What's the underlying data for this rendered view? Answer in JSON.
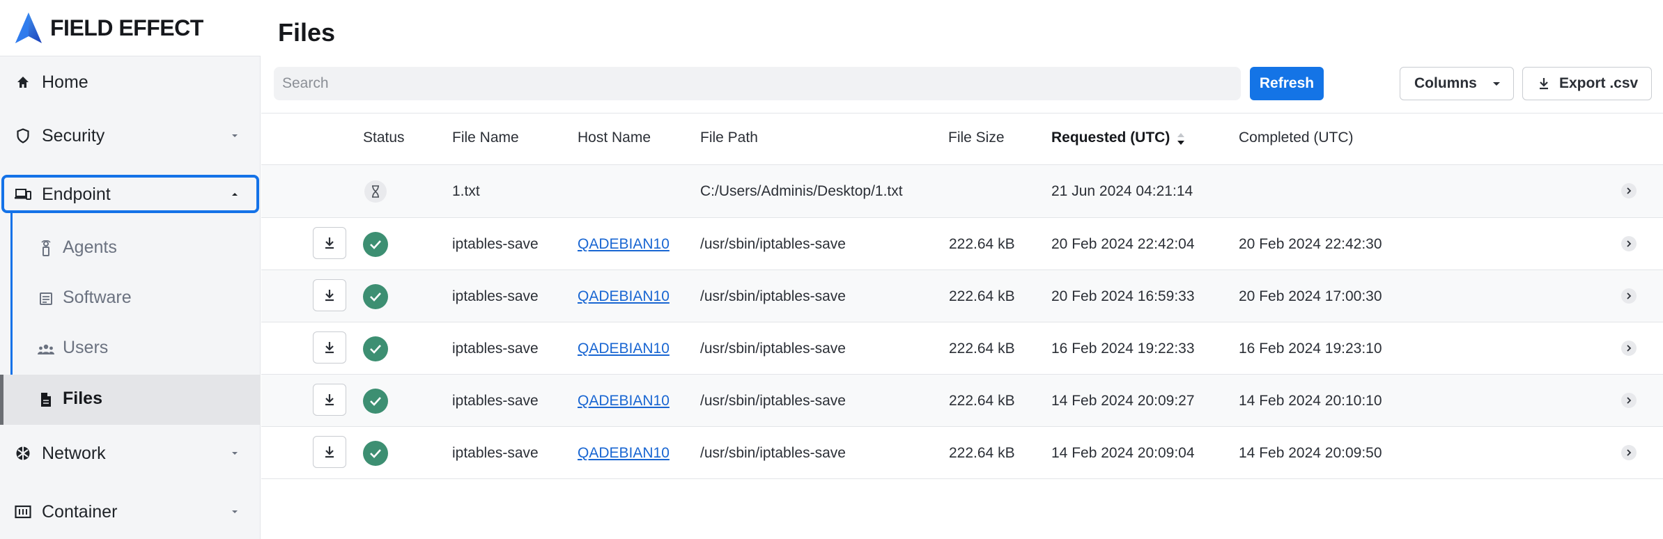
{
  "brand": {
    "name": "FIELD EFFECT"
  },
  "sidebar": {
    "items": [
      {
        "label": "Home",
        "icon": "home-icon"
      },
      {
        "label": "Security",
        "icon": "shield-icon"
      },
      {
        "label": "Endpoint",
        "icon": "devices-icon",
        "expanded": true
      },
      {
        "label": "Network",
        "icon": "network-icon"
      },
      {
        "label": "Container",
        "icon": "container-icon"
      }
    ],
    "endpoint_children": [
      {
        "label": "Agents",
        "icon": "agent-icon"
      },
      {
        "label": "Software",
        "icon": "software-icon"
      },
      {
        "label": "Users",
        "icon": "users-icon"
      },
      {
        "label": "Files",
        "icon": "file-icon",
        "active": true
      }
    ]
  },
  "page": {
    "title": "Files",
    "search_placeholder": "Search",
    "refresh_label": "Refresh",
    "columns_label": "Columns",
    "export_label": "Export .csv"
  },
  "table": {
    "headers": {
      "status": "Status",
      "file_name": "File Name",
      "host_name": "Host Name",
      "file_path": "File Path",
      "file_size": "File Size",
      "requested": "Requested (UTC)",
      "completed": "Completed (UTC)"
    },
    "sorted_column": "requested",
    "rows": [
      {
        "status": "pending",
        "file_name": "1.txt",
        "host_name": "",
        "file_path": "C:/Users/Adminis/Desktop/1.txt",
        "file_size": "",
        "requested": "21 Jun 2024 04:21:14",
        "completed": ""
      },
      {
        "status": "complete",
        "file_name": "iptables-save",
        "host_name": "QADEBIAN10",
        "file_path": "/usr/sbin/iptables-save",
        "file_size": "222.64 kB",
        "requested": "20 Feb 2024 22:42:04",
        "completed": "20 Feb 2024 22:42:30"
      },
      {
        "status": "complete",
        "file_name": "iptables-save",
        "host_name": "QADEBIAN10",
        "file_path": "/usr/sbin/iptables-save",
        "file_size": "222.64 kB",
        "requested": "20 Feb 2024 16:59:33",
        "completed": "20 Feb 2024 17:00:30"
      },
      {
        "status": "complete",
        "file_name": "iptables-save",
        "host_name": "QADEBIAN10",
        "file_path": "/usr/sbin/iptables-save",
        "file_size": "222.64 kB",
        "requested": "16 Feb 2024 19:22:33",
        "completed": "16 Feb 2024 19:23:10"
      },
      {
        "status": "complete",
        "file_name": "iptables-save",
        "host_name": "QADEBIAN10",
        "file_path": "/usr/sbin/iptables-save",
        "file_size": "222.64 kB",
        "requested": "14 Feb 2024 20:09:27",
        "completed": "14 Feb 2024 20:10:10"
      },
      {
        "status": "complete",
        "file_name": "iptables-save",
        "host_name": "QADEBIAN10",
        "file_path": "/usr/sbin/iptables-save",
        "file_size": "222.64 kB",
        "requested": "14 Feb 2024 20:09:04",
        "completed": "14 Feb 2024 20:09:50"
      }
    ]
  },
  "colors": {
    "accent": "#1474e6",
    "status_ok": "#3d8f72",
    "link": "#1966d2"
  }
}
